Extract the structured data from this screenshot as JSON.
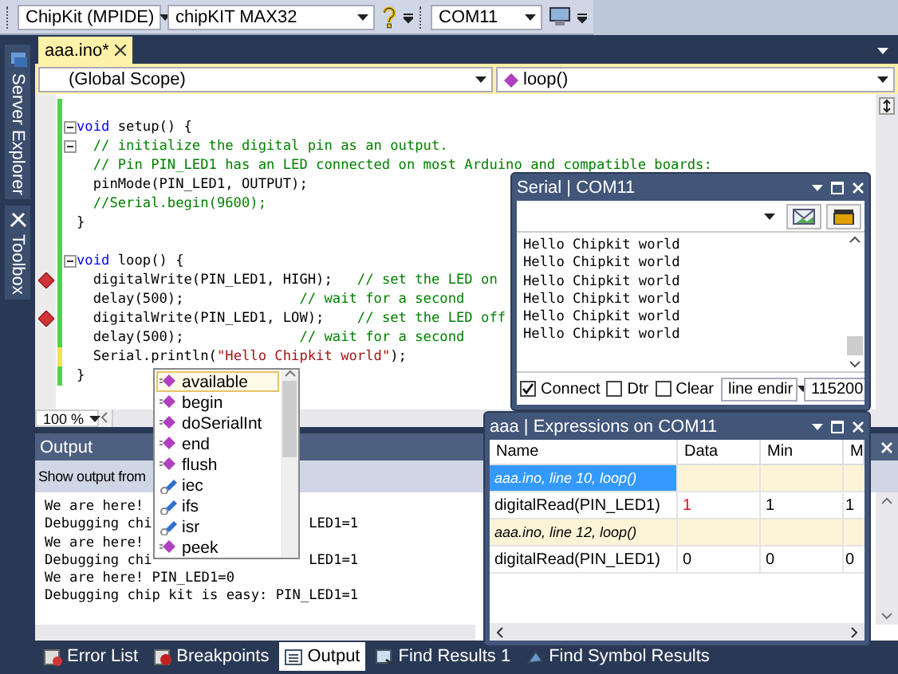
{
  "toolbar": {
    "combos": [
      {
        "value": "ChipKit (MPIDE)"
      },
      {
        "value": "chipKIT MAX32"
      },
      {
        "value": "COM11"
      }
    ]
  },
  "side_tabs": [
    {
      "label": "Server Explorer"
    },
    {
      "label": "Toolbox"
    }
  ],
  "editor": {
    "tabs": [
      {
        "label": "aaa.ino*",
        "selected": true
      }
    ],
    "scope": "(Global Scope)",
    "member": "loop()",
    "zoom": "100 %",
    "lines": [
      {
        "unsaved": false,
        "collapsible": false,
        "breakpoint": false
      },
      {
        "unsaved": false,
        "collapsible": true,
        "breakpoint": false,
        "segments": [
          {
            "kind": "keyword",
            "text": "void"
          },
          {
            "kind": "code",
            "text": " setup() {"
          }
        ]
      },
      {
        "unsaved": false,
        "collapsible": true,
        "breakpoint": false,
        "segments": [
          {
            "kind": "comment",
            "text": "  // initialize the digital pin as an output."
          }
        ]
      },
      {
        "unsaved": false,
        "collapsible": false,
        "breakpoint": false,
        "segments": [
          {
            "kind": "comment",
            "text": "  // Pin PIN_LED1 has an LED connected on most Arduino and compatible boards:"
          }
        ]
      },
      {
        "unsaved": false,
        "collapsible": false,
        "breakpoint": false,
        "segments": [
          {
            "kind": "code",
            "text": "  pinMode(PIN_LED1, OUTPUT);"
          }
        ]
      },
      {
        "unsaved": false,
        "collapsible": false,
        "breakpoint": false,
        "segments": [
          {
            "kind": "comment",
            "text": "  //Serial.begin(9600);"
          }
        ]
      },
      {
        "unsaved": false,
        "collapsible": false,
        "breakpoint": false,
        "segments": [
          {
            "kind": "code",
            "text": "}"
          }
        ]
      },
      {
        "unsaved": false,
        "collapsible": false,
        "breakpoint": false
      },
      {
        "unsaved": false,
        "collapsible": true,
        "breakpoint": false,
        "segments": [
          {
            "kind": "keyword",
            "text": "void"
          },
          {
            "kind": "code",
            "text": " loop() {"
          }
        ]
      },
      {
        "unsaved": false,
        "collapsible": false,
        "breakpoint": true,
        "segments": [
          {
            "kind": "code",
            "text": "  digitalWrite(PIN_LED1, HIGH);   "
          },
          {
            "kind": "comment",
            "text": "// set the LED on"
          }
        ]
      },
      {
        "unsaved": false,
        "collapsible": false,
        "breakpoint": false,
        "segments": [
          {
            "kind": "code",
            "text": "  delay(500);              "
          },
          {
            "kind": "comment",
            "text": "// wait for a second"
          }
        ]
      },
      {
        "unsaved": false,
        "collapsible": false,
        "breakpoint": true,
        "segments": [
          {
            "kind": "code",
            "text": "  digitalWrite(PIN_LED1, LOW);    "
          },
          {
            "kind": "comment",
            "text": "// set the LED off"
          }
        ]
      },
      {
        "unsaved": false,
        "collapsible": false,
        "breakpoint": false,
        "segments": [
          {
            "kind": "code",
            "text": "  delay(500);              "
          },
          {
            "kind": "comment",
            "text": "// wait for a second"
          }
        ]
      },
      {
        "unsaved": true,
        "collapsible": false,
        "breakpoint": false,
        "segments": [
          {
            "kind": "code",
            "text": "  Serial.println("
          },
          {
            "kind": "string",
            "text": "\"Hello Chipkit world\""
          },
          {
            "kind": "code",
            "text": ");"
          }
        ]
      },
      {
        "unsaved": false,
        "collapsible": false,
        "breakpoint": false,
        "segments": [
          {
            "kind": "code",
            "text": "}"
          }
        ]
      }
    ]
  },
  "completion": {
    "items": [
      {
        "label": "available",
        "kind": "method",
        "selected": true
      },
      {
        "label": "begin",
        "kind": "method",
        "selected": false
      },
      {
        "label": "doSerialInt",
        "kind": "method",
        "selected": false
      },
      {
        "label": "end",
        "kind": "method",
        "selected": false
      },
      {
        "label": "flush",
        "kind": "method",
        "selected": false
      },
      {
        "label": "iec",
        "kind": "field",
        "selected": false
      },
      {
        "label": "ifs",
        "kind": "field",
        "selected": false
      },
      {
        "label": "isr",
        "kind": "field",
        "selected": false
      },
      {
        "label": "peek",
        "kind": "method",
        "selected": false
      }
    ]
  },
  "output": {
    "title": "Output",
    "source_label": "Show output from",
    "lines": [
      {
        "start": "We are here!"
      },
      {
        "start": "Debugging chi",
        "end": "LED1=1"
      },
      {
        "start": "We are here!"
      },
      {
        "start": "Debugging chi",
        "end": "LED1=1"
      },
      {
        "start": "We are here! PIN_LED1=0"
      },
      {
        "start": "Debugging chip kit is easy: PIN_LED1=1"
      }
    ]
  },
  "serial": {
    "title": "Serial | COM11",
    "lines": [
      "Hello Chipkit world",
      "Hello Chipkit world",
      "Hello Chipkit world",
      "Hello Chipkit world",
      "Hello Chipkit world",
      "Hello Chipkit world"
    ],
    "options": [
      {
        "label": "Connect",
        "checked": true
      },
      {
        "label": "Dtr",
        "checked": false
      },
      {
        "label": "Clear",
        "checked": false
      }
    ],
    "line_ending": "line endir",
    "baud": "115200"
  },
  "expressions": {
    "title": "aaa | Expressions on COM11",
    "columns": [
      "Name",
      "Data",
      "Min",
      "M"
    ],
    "rows": [
      {
        "kind": "group",
        "name": "aaa.ino, line 10, loop()",
        "selected": true
      },
      {
        "kind": "value",
        "name": "digitalRead(PIN_LED1)",
        "cells": [
          "1",
          "1",
          "1"
        ],
        "changed": true
      },
      {
        "kind": "group",
        "name": "aaa.ino, line 12, loop()",
        "selected": false
      },
      {
        "kind": "value",
        "name": "digitalRead(PIN_LED1)",
        "cells": [
          "0",
          "0",
          "0"
        ],
        "changed": false
      }
    ]
  },
  "bottom_tabs": [
    {
      "label": "Error List",
      "selected": false
    },
    {
      "label": "Breakpoints",
      "selected": false
    },
    {
      "label": "Output",
      "selected": true
    },
    {
      "label": "Find Results 1",
      "selected": false
    },
    {
      "label": "Find Symbol Results",
      "selected": false
    }
  ]
}
